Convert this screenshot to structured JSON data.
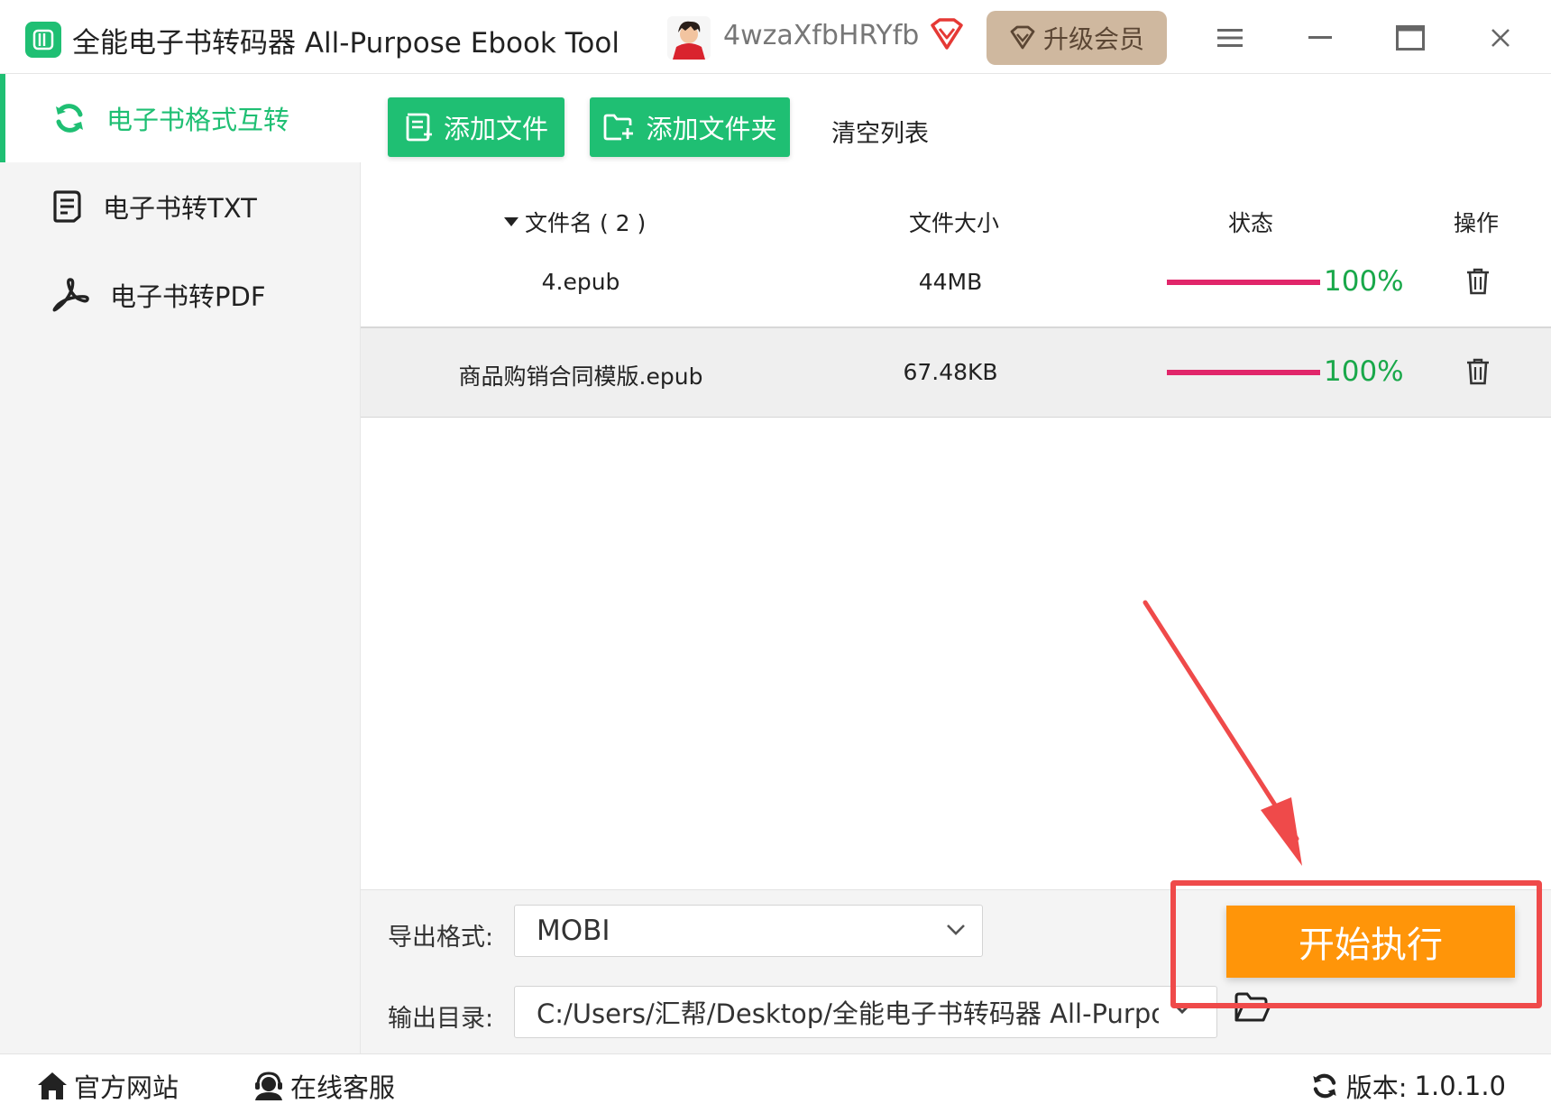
{
  "titlebar": {
    "title": "全能电子书转码器 All-Purpose Ebook Tool",
    "username": "4wzaXfbHRYfb",
    "upgrade_label": "升级会员"
  },
  "sidebar": {
    "items": [
      {
        "label": "电子书格式互转",
        "icon": "refresh-icon",
        "active": true
      },
      {
        "label": "电子书转TXT",
        "icon": "document-icon",
        "active": false
      },
      {
        "label": "电子书转PDF",
        "icon": "pdf-icon",
        "active": false
      }
    ]
  },
  "toolbar": {
    "add_file_label": "添加文件",
    "add_folder_label": "添加文件夹",
    "clear_label": "清空列表"
  },
  "table": {
    "headers": {
      "name": "文件名 ( 2 )",
      "size": "文件大小",
      "status": "状态",
      "action": "操作"
    },
    "rows": [
      {
        "name": "4.epub",
        "size": "44MB",
        "progress_text": "100%",
        "progress": 100
      },
      {
        "name": "商品购销合同模版.epub",
        "size": "67.48KB",
        "progress_text": "100%",
        "progress": 100
      }
    ]
  },
  "settings": {
    "format_label": "导出格式:",
    "format_value": "MOBI",
    "dir_label": "输出目录:",
    "dir_value": "C:/Users/汇帮/Desktop/全能电子书转码器 All-Purpo:"
  },
  "start_label": "开始执行",
  "footer": {
    "website_label": "官方网站",
    "support_label": "在线客服",
    "version_label": "版本:",
    "version_value": "1.0.1.0"
  },
  "colors": {
    "accent": "#1fbf73",
    "start": "#ff9509",
    "progress": "#e1266a",
    "progress_text": "#19a84a",
    "upgrade": "#cfb89f",
    "annotation": "#ef4a4a"
  }
}
